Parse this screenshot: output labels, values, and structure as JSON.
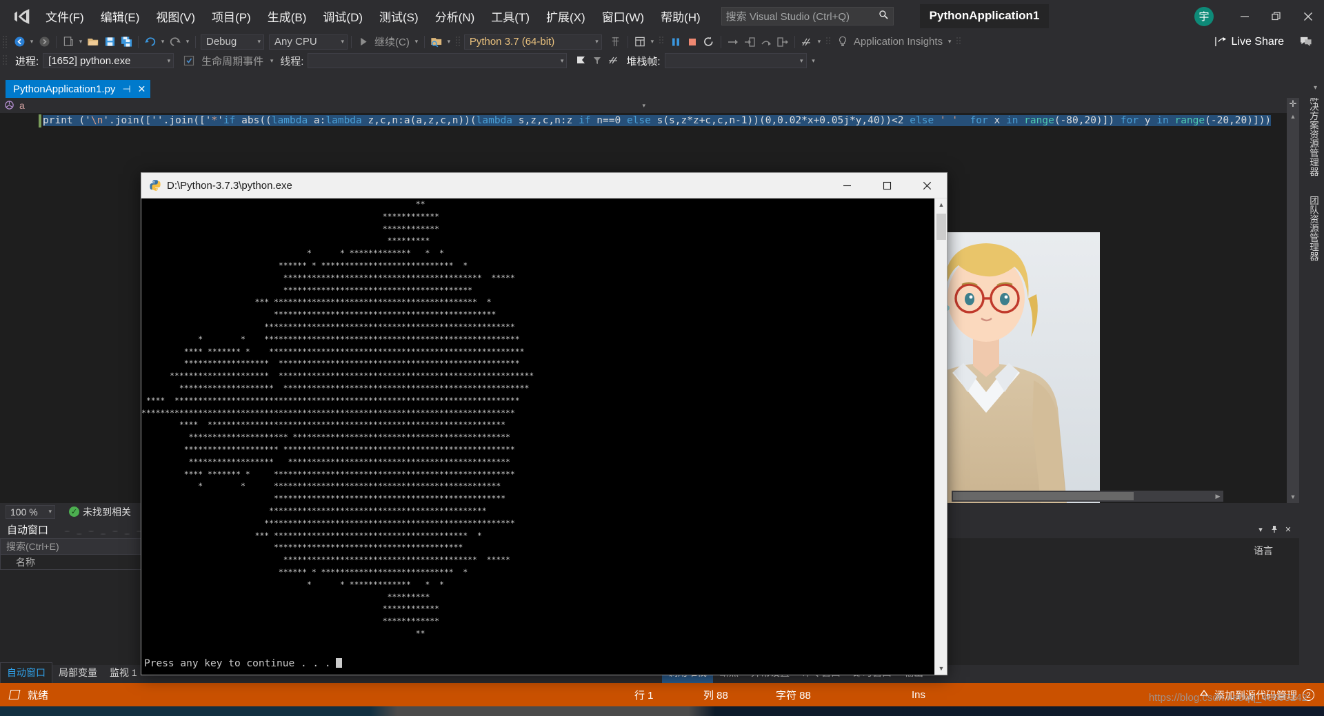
{
  "window": {
    "solution_name": "PythonApplication1",
    "avatar_initial": "宇",
    "minimize": "—",
    "restore": "❐",
    "close": "✕"
  },
  "menu": {
    "items": [
      {
        "label": "文件(F)",
        "name": "menu-file"
      },
      {
        "label": "编辑(E)",
        "name": "menu-edit"
      },
      {
        "label": "视图(V)",
        "name": "menu-view"
      },
      {
        "label": "项目(P)",
        "name": "menu-project"
      },
      {
        "label": "生成(B)",
        "name": "menu-build"
      },
      {
        "label": "调试(D)",
        "name": "menu-debug"
      },
      {
        "label": "测试(S)",
        "name": "menu-test"
      },
      {
        "label": "分析(N)",
        "name": "menu-analyze"
      },
      {
        "label": "工具(T)",
        "name": "menu-tools"
      },
      {
        "label": "扩展(X)",
        "name": "menu-extensions"
      },
      {
        "label": "窗口(W)",
        "name": "menu-window"
      },
      {
        "label": "帮助(H)",
        "name": "menu-help"
      }
    ],
    "search_placeholder": "搜索 Visual Studio (Ctrl+Q)"
  },
  "toolbar": {
    "configuration": "Debug",
    "platform": "Any CPU",
    "continue_label": "继续(C)",
    "interpreter": "Python 3.7 (64-bit)",
    "app_insights": "Application Insights",
    "live_share": "Live Share"
  },
  "debugbar": {
    "process_label": "进程:",
    "process_value": "[1652] python.exe",
    "lifecycle_events": "生命周期事件",
    "thread_label": "线程:",
    "thread_value": "",
    "stackframe_label": "堆栈帧:",
    "stackframe_value": ""
  },
  "editor": {
    "tab_title": "PythonApplication1.py",
    "tab_pin": "⊣",
    "tab_close": "✕",
    "navbar_symbol": "a",
    "zoom_level": "100 %",
    "error_status": "未找到相关",
    "error_ok_glyph": "✓",
    "code_line": "print ('\\n'.join([''.join(['*'if abs((lambda a:lambda z,c,n:a(a,z,c,n))(lambda s,z,c,n:z if n==0 else s(s,z*z+c,c,n-1))(0,0.02*x+0.05j*y,40))<2 else ' ' for x in range(-80,20)]) for y in range(-20,20)]))",
    "code_tokens": [
      {
        "t": "print ('",
        "c": "def"
      },
      {
        "t": "\\n",
        "c": "str-esc"
      },
      {
        "t": "'.join(['",
        "c": "def"
      },
      {
        "t": "'.join(['",
        "c": "def2"
      },
      {
        "t": "*",
        "c": "str"
      },
      {
        "t": "'",
        "c": "def"
      },
      {
        "t": "if",
        "c": "kw"
      },
      {
        "t": " abs((",
        "c": "def"
      },
      {
        "t": "lambda",
        "c": "kw"
      },
      {
        "t": " a:",
        "c": "def"
      },
      {
        "t": "lambda",
        "c": "kw"
      },
      {
        "t": " z,c,n:a(a,z,c,n))(",
        "c": "def"
      },
      {
        "t": "lambda",
        "c": "kw"
      },
      {
        "t": " s,z,c,n:z ",
        "c": "def"
      },
      {
        "t": "if",
        "c": "kw"
      },
      {
        "t": " n==0 ",
        "c": "def"
      },
      {
        "t": "else",
        "c": "kw"
      },
      {
        "t": " s(s,z*z+c,c,n-1))(0,0.02*x+0.05j*y,40))<2 ",
        "c": "def"
      },
      {
        "t": "else",
        "c": "kw"
      },
      {
        "t": " ' '  ",
        "c": "str"
      },
      {
        "t": "for",
        "c": "kw"
      },
      {
        "t": " x ",
        "c": "def"
      },
      {
        "t": "in",
        "c": "kw"
      },
      {
        "t": " range",
        "c": "fn"
      },
      {
        "t": "(-80,20)]) ",
        "c": "def"
      },
      {
        "t": "for",
        "c": "kw"
      },
      {
        "t": " y ",
        "c": "def"
      },
      {
        "t": "in",
        "c": "kw"
      },
      {
        "t": " range",
        "c": "fn"
      },
      {
        "t": "(-20,20)]))",
        "c": "def"
      }
    ]
  },
  "right_dock": {
    "tabs": [
      "解决方案资源管理器",
      "团队资源管理器"
    ]
  },
  "autos_panel": {
    "title": "自动窗口",
    "search_placeholder": "搜索(Ctrl+E)",
    "column_name": "名称",
    "lang_label": "语言",
    "pin": "📌",
    "close": "✕",
    "dropdown": "▾"
  },
  "bottom_tabs_left": [
    {
      "label": "自动窗口",
      "active": true
    },
    {
      "label": "局部变量",
      "active": false
    },
    {
      "label": "监视 1",
      "active": false
    }
  ],
  "bottom_tabs_right": [
    {
      "label": "调用堆栈",
      "highlight": true
    },
    {
      "label": "断点",
      "highlight": false
    },
    {
      "label": "异常设置",
      "highlight": false
    },
    {
      "label": "命令窗口",
      "highlight": false
    },
    {
      "label": "即时窗口",
      "highlight": false
    },
    {
      "label": "输出",
      "highlight": false
    }
  ],
  "statusbar": {
    "ready": "就绪",
    "line_label": "行 1",
    "col_label": "列 88",
    "char_label": "字符 88",
    "insert_mode": "Ins",
    "source_control": "添加到源代码管理",
    "source_control_badge": "2",
    "watermark": "https://blog.csdn.net/qq_40695242",
    "accent_color": "#ca5100"
  },
  "console": {
    "title": "D:\\Python-3.7.3\\python.exe",
    "minimize": "—",
    "maximize": "❐",
    "close": "✕",
    "prompt": "Press any key to continue . . .",
    "ascii_art": [
      "                                                          **",
      "                                                   ************",
      "                                                   ************",
      "                                                    *********",
      "                                   *      * *************   *  *",
      "                             ****** * ****************************  *",
      "                              ******************************************  *****",
      "                              ****************************************",
      "                        *** *******************************************  *",
      "                            ***********************************************",
      "                          *****************************************************",
      "            *        *    ******************************************************",
      "         **** ******* *    ******************************************************",
      "         ******************  ***************************************************",
      "      *********************  ******************************************************",
      "        ********************  ****************************************************",
      " ****  *************************************************************************",
      "*******************************************************************************",
      "        ****  ***************************************************************",
      "          ********************* **********************************************",
      "         ******************** *************************************************",
      "          ******************   ***********************************************",
      "         **** ******* *     ***************************************************",
      "            *        *      ************************************************",
      "                            *************************************************",
      "                           **********************************************",
      "                          *****************************************************",
      "                        *** *****************************************  *",
      "                            ****************************************",
      "                              *****************************************  *****",
      "                             ****** * ****************************  *",
      "                                   *      * *************   *  *",
      "                                                    *********",
      "                                                   ************",
      "                                                   ************",
      "                                                          **"
    ]
  }
}
